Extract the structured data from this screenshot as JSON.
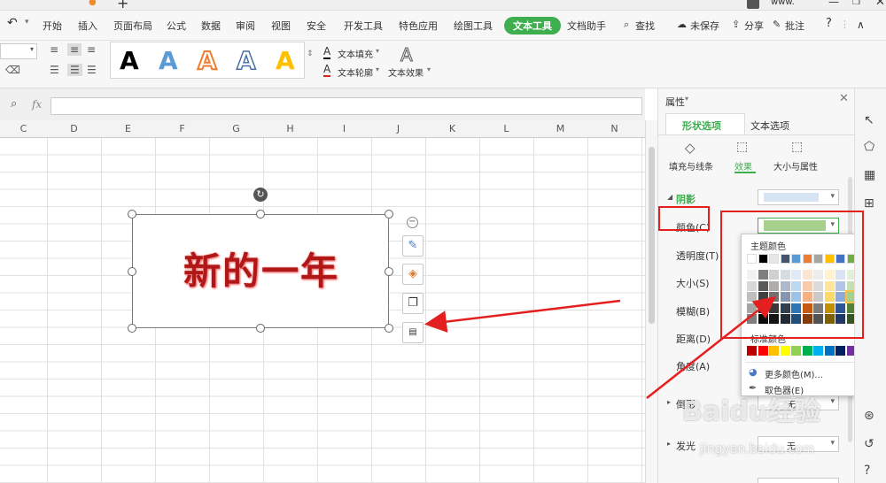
{
  "menubar": {
    "items": [
      "开始",
      "插入",
      "页面布局",
      "公式",
      "数据",
      "审阅",
      "视图",
      "安全",
      "开发工具",
      "特色应用",
      "绘图工具",
      "文本工具",
      "文档助手",
      "查找"
    ],
    "active": "文本工具",
    "unsaved": "未保存",
    "share": "分享",
    "comment": "批注",
    "help": "?",
    "titlebar_user": "www."
  },
  "ribbon": {
    "art_styles": [
      "A",
      "A",
      "A",
      "A",
      "A"
    ],
    "text_fill": "文本填充",
    "text_outline": "文本轮廓",
    "text_effect": "文本效果",
    "text_effect_icon": "A"
  },
  "formula": {
    "fx": "fx"
  },
  "columns": [
    "C",
    "D",
    "E",
    "F",
    "G",
    "H",
    "I",
    "J",
    "K",
    "L",
    "M",
    "N"
  ],
  "textbox": {
    "text": "新的一年"
  },
  "panel": {
    "title": "属性",
    "tabs": [
      "形状选项",
      "文本选项"
    ],
    "subtabs": [
      "填充与线条",
      "效果",
      "大小与属性"
    ],
    "section_shadow": "阴影",
    "labels": [
      "颜色(C)",
      "透明度(T)",
      "大小(S)",
      "模糊(B)",
      "距离(D)",
      "角度(A)"
    ],
    "reflection": "倒影",
    "glow": "发光",
    "reflection_value": "无",
    "glow_value": "无"
  },
  "popup": {
    "theme_title": "主题颜色",
    "standard_title": "标准颜色",
    "more_colors": "更多颜色(M)...",
    "eyedropper": "取色器(E)"
  },
  "watermark": {
    "logo": "Baidu经验",
    "url": "jingyan.baidu.com"
  },
  "colors": {
    "accent_green": "#3fae4f",
    "annotation_red": "#e41f1f",
    "shadow_green": "#a8d08d",
    "standard": [
      "#c00000",
      "#ff0000",
      "#ffc000",
      "#ffff00",
      "#92d050",
      "#00b050",
      "#00b0f0",
      "#0070c0",
      "#002060",
      "#7030a0"
    ]
  }
}
